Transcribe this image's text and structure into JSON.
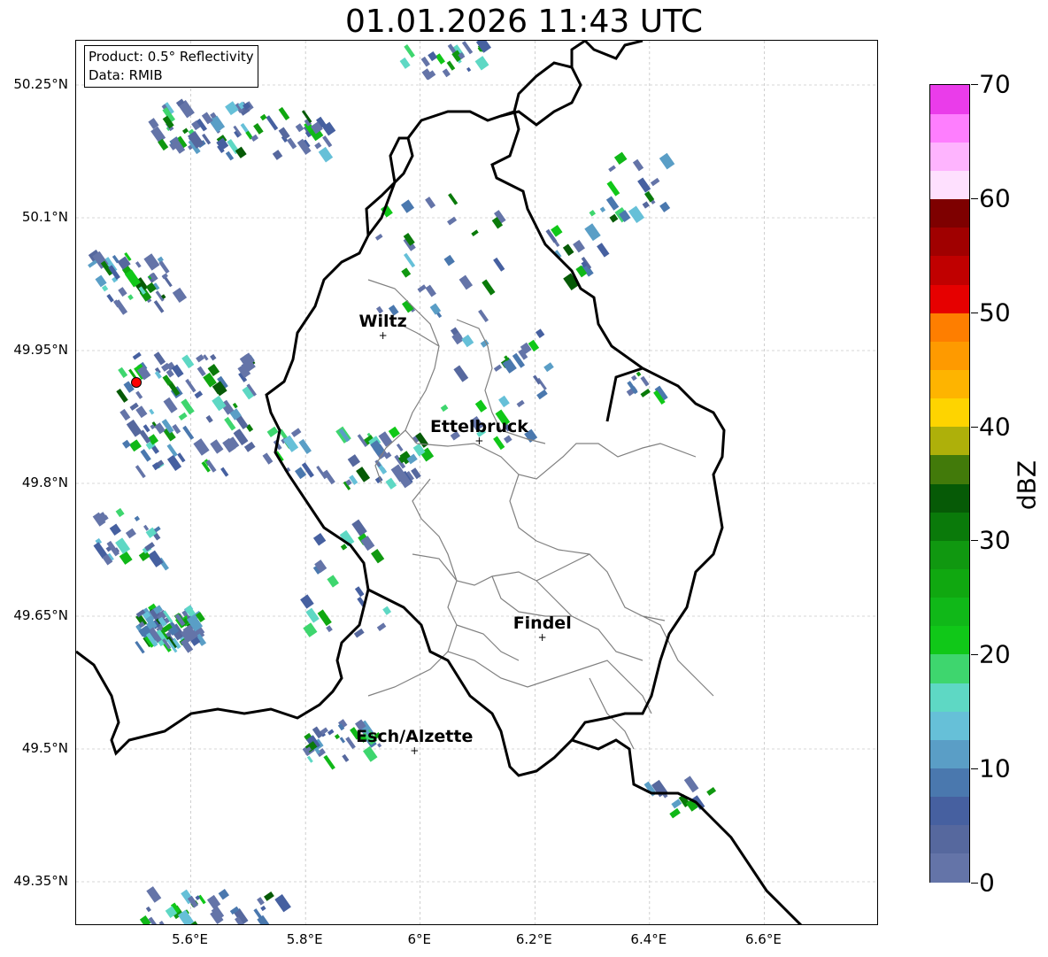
{
  "title": "01.01.2026 11:43 UTC",
  "info": {
    "product": "Product: 0.5° Reflectivity",
    "data": "Data: RMIB"
  },
  "axes": {
    "lat_labels": [
      "50.25°N",
      "50.1°N",
      "49.95°N",
      "49.8°N",
      "49.65°N",
      "49.5°N",
      "49.35°N"
    ],
    "lon_labels": [
      "5.6°E",
      "5.8°E",
      "6°E",
      "6.2°E",
      "6.4°E",
      "6.6°E"
    ],
    "lat_values": [
      50.25,
      50.1,
      49.95,
      49.8,
      49.65,
      49.5,
      49.35
    ],
    "lon_values": [
      5.6,
      5.8,
      6.0,
      6.2,
      6.4,
      6.6
    ],
    "lon_range": [
      5.4,
      6.8
    ],
    "lat_range": [
      49.3,
      50.3
    ],
    "grid": true
  },
  "cities": [
    {
      "name": "Wiltz",
      "lon": 5.935,
      "lat": 49.967
    },
    {
      "name": "Ettelbruck",
      "lon": 6.103,
      "lat": 49.848
    },
    {
      "name": "Findel",
      "lon": 6.213,
      "lat": 49.626
    },
    {
      "name": "Esch/Alzette",
      "lon": 5.99,
      "lat": 49.498
    }
  ],
  "radar_site": {
    "lon": 5.505,
    "lat": 49.914,
    "color": "#ff0000"
  },
  "colorbar": {
    "label": "dBZ",
    "min": 0,
    "max": 70,
    "tick_labels": [
      "0",
      "10",
      "20",
      "30",
      "40",
      "50",
      "60",
      "70"
    ],
    "colors": [
      "#6474a8",
      "#56689e",
      "#4660a0",
      "#4a78ae",
      "#5a9ec6",
      "#66c0d8",
      "#5ed8c4",
      "#3ed66e",
      "#10c818",
      "#10b818",
      "#10a810",
      "#109810",
      "#0a7a0a",
      "#065a06",
      "#427a0a",
      "#aeb00a",
      "#fed400",
      "#feb400",
      "#fe9a00",
      "#fe7e00",
      "#e60000",
      "#c00000",
      "#a00000",
      "#7e0000",
      "#fee0fe",
      "#feb4fe",
      "#fe7efe",
      "#ea3cea"
    ]
  },
  "legend_colors": {
    "border": "#000000",
    "district_lines": "#808080",
    "grid": "#b0b0b0"
  }
}
